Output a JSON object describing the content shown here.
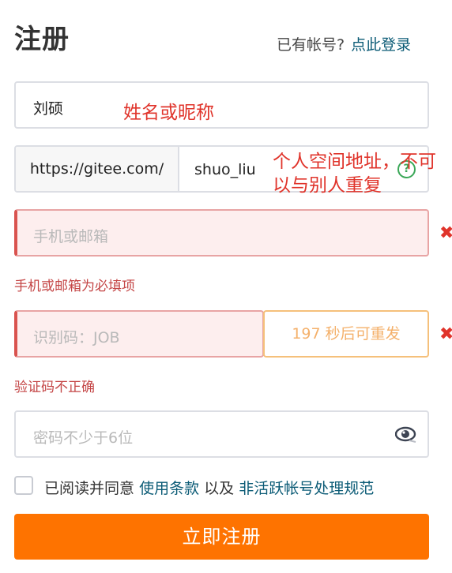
{
  "header": {
    "title": "注册",
    "have_account": "已有帐号?",
    "login_link": "点此登录"
  },
  "form": {
    "name_value": "刘硕",
    "url_prefix": "https://gitee.com/",
    "url_value": "shuo_liu",
    "phone_placeholder": "手机或邮箱",
    "phone_error": "手机或邮箱为必填项",
    "code_placeholder": "识别码：JOB",
    "code_button": "197 秒后可重发",
    "code_error": "验证码不正确",
    "password_placeholder": "密码不少于6位",
    "agree_text": "已阅读并同意",
    "terms_link": "使用条款",
    "and_text": "以及",
    "policy_link": "非活跃帐号处理规范",
    "submit_label": "立即注册"
  },
  "annotations": {
    "name_note": "姓名或昵称",
    "url_note": "个人空间地址，不可以与别人重复"
  },
  "icons": {
    "help": "?",
    "error": "✖",
    "eye": "eye-icon"
  },
  "colors": {
    "primary_button": "#fe7300",
    "link": "#0b5b76",
    "error": "#e0342b",
    "annotation": "#e0342b"
  }
}
